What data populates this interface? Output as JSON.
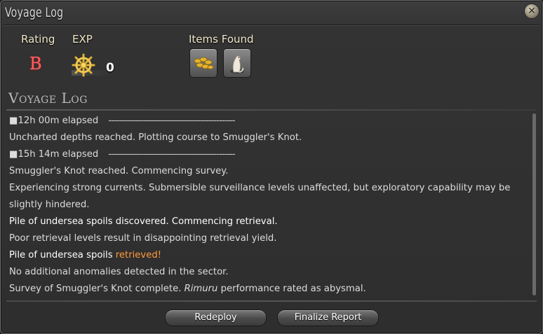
{
  "window": {
    "title": "Voyage Log"
  },
  "summary": {
    "rating_label": "Rating",
    "rating_value": "B",
    "exp_label": "EXP",
    "exp_value": "0",
    "items_label": "Items Found",
    "items": [
      {
        "icon": "gold-coins-icon"
      },
      {
        "icon": "white-ferret-icon"
      }
    ]
  },
  "log": {
    "heading": "Voyage Log",
    "entries": [
      {
        "time": "■12h 00m elapsed",
        "dashes": "------------------------------------------------"
      },
      {
        "text": "Uncharted depths reached. Plotting course to Smuggler's Knot."
      },
      {
        "time": "■15h 14m elapsed",
        "dashes": "------------------------------------------------"
      },
      {
        "text": "Smuggler's Knot reached. Commencing survey."
      },
      {
        "text": "Experiencing strong currents. Submersible surveillance levels unaffected, but exploratory capability may be slightly hindered."
      },
      {
        "text": "Pile of undersea spoils discovered. Commencing retrieval."
      },
      {
        "text": "Poor retrieval levels result in disappointing retrieval yield."
      },
      {
        "text": "Pile of undersea spoils",
        "highlight": "retrieved!"
      },
      {
        "text": "No additional anomalies detected in the sector."
      },
      {
        "text_before": "Survey of Smuggler's Knot complete.",
        "italic": "Rimuru",
        "text_after": "performance rated as abysmal."
      }
    ]
  },
  "buttons": {
    "redeploy": "Redeploy",
    "finalize": "Finalize Report"
  },
  "colors": {
    "rating": "#ff5a5a",
    "highlight": "#ff9a3a",
    "label": "#efe6c8"
  }
}
